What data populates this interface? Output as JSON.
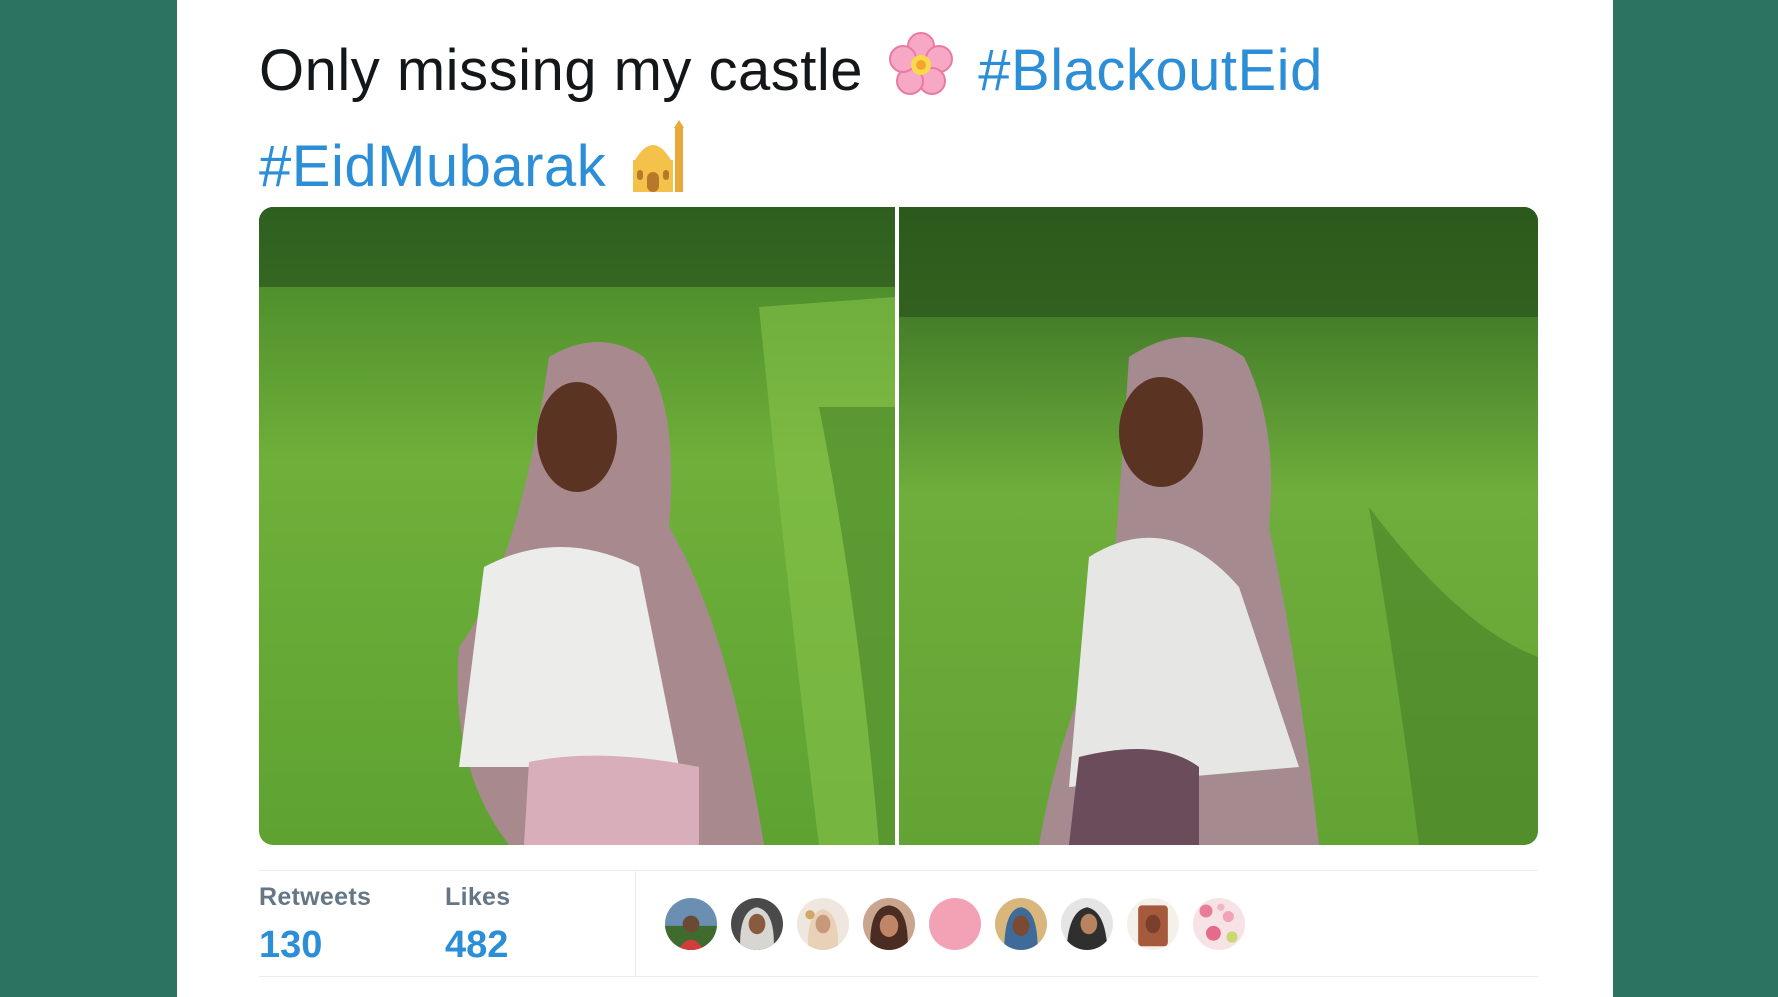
{
  "tweet": {
    "text": "Only missing my castle",
    "emoji_1": "cherry-blossom-icon",
    "hashtag_1": "#BlackoutEid",
    "hashtag_2": "#EidMubarak",
    "emoji_2": "mosque-icon"
  },
  "stats": {
    "retweets_label": "Retweets",
    "retweets_count": "130",
    "likes_label": "Likes",
    "likes_count": "482"
  },
  "liked_by_avatars": 9,
  "colors": {
    "background": "#2d7361",
    "card": "#ffffff",
    "text": "#14171a",
    "hashtag": "#2b8ed6",
    "stat_label": "#657786"
  }
}
